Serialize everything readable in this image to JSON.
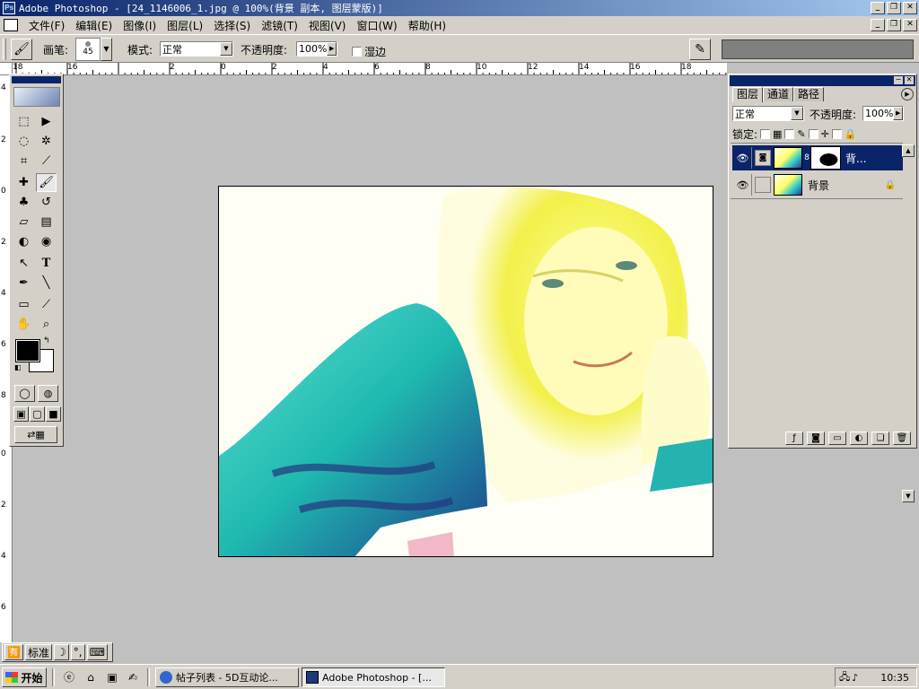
{
  "titlebar": {
    "title": "Adobe Photoshop - [24_1146006_1.jpg @ 100%(背景 副本, 图层蒙版)]"
  },
  "menubar": {
    "items": [
      "文件(F)",
      "编辑(E)",
      "图像(I)",
      "图层(L)",
      "选择(S)",
      "滤镜(T)",
      "视图(V)",
      "窗口(W)",
      "帮助(H)"
    ]
  },
  "options": {
    "brush_label": "画笔:",
    "brush_size": "45",
    "mode_label": "模式:",
    "mode_value": "正常",
    "opacity_label": "不透明度:",
    "opacity_value": "100%",
    "wet_edges_label": "湿边"
  },
  "rulers": {
    "top": [
      "18",
      "16",
      "2",
      "0",
      "2",
      "4",
      "6",
      "8",
      "10",
      "12",
      "14",
      "16",
      "18",
      "20",
      "22",
      "24",
      "26"
    ],
    "left": [
      "4",
      "2",
      "0",
      "2",
      "4",
      "6",
      "8",
      "0",
      "2",
      "4",
      "6"
    ]
  },
  "layers_panel": {
    "tabs": [
      "图层",
      "通道",
      "路径"
    ],
    "blend_mode": "正常",
    "opacity_label": "不透明度:",
    "opacity_value": "100%",
    "lock_label": "锁定:",
    "layers": [
      {
        "name": "背...",
        "selected": true,
        "has_mask": true
      },
      {
        "name": "背景",
        "selected": false,
        "locked": true
      }
    ]
  },
  "ime": {
    "mode": "标准"
  },
  "taskbar": {
    "start_label": "开始",
    "tasks": [
      {
        "label": "帖子列表 - 5D互动论...",
        "active": false
      },
      {
        "label": "Adobe Photoshop - [...",
        "active": true
      }
    ],
    "clock": "10:35"
  },
  "colors": {
    "titlebar": "#0a246a",
    "face": "#d4d0c8",
    "workspace": "#c0c0c0"
  }
}
